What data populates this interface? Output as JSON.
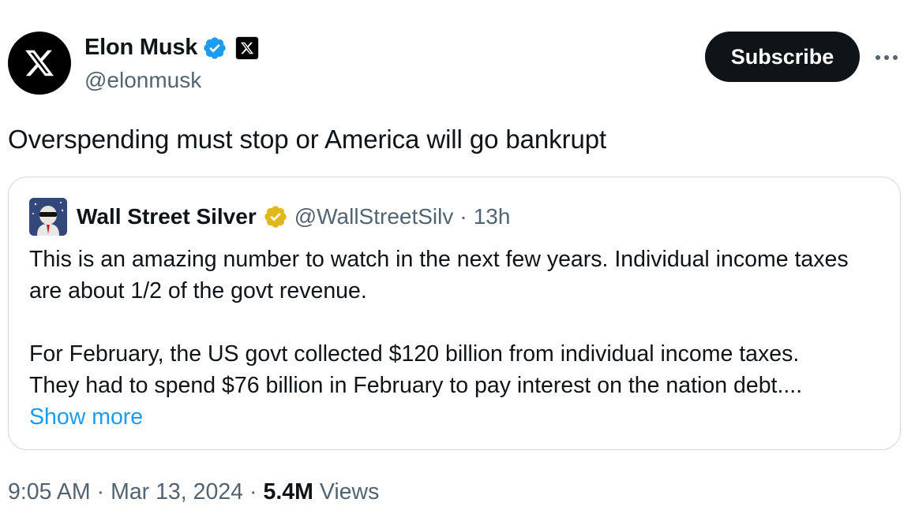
{
  "author": {
    "display_name": "Elon Musk",
    "handle": "@elonmusk",
    "verified_icon": "verified-blue-badge-icon",
    "affiliation_icon": "x-logo-icon",
    "avatar_icon": "x-logo-icon"
  },
  "actions": {
    "subscribe_label": "Subscribe",
    "more_icon": "more-options-icon"
  },
  "tweet": {
    "text": "Overspending must stop or America will go bankrupt"
  },
  "quote": {
    "display_name": "Wall Street Silver",
    "verified_icon": "verified-gold-badge-icon",
    "handle": "@WallStreetSilv",
    "separator": "·",
    "time": "13h",
    "paragraph_1": "This is an amazing number to watch in the next few years. Individual income taxes are about 1/2 of the govt revenue.",
    "paragraph_2_line_1": "For February, the US govt collected $120 billion from individual income taxes.",
    "paragraph_2_line_2": "They had to spend $76 billion in February to pay interest on the nation debt....",
    "show_more": "Show more"
  },
  "meta": {
    "time": "9:05 AM",
    "sep1": "·",
    "date": "Mar 13, 2024",
    "sep2": "·",
    "views_count": "5.4M",
    "views_label": "Views"
  },
  "colors": {
    "text": "#0f1419",
    "secondary": "#536471",
    "link": "#1d9bf0",
    "verified_blue": "#1d9bf0",
    "verified_gold": "#e2b719",
    "border": "#cfd9de"
  }
}
